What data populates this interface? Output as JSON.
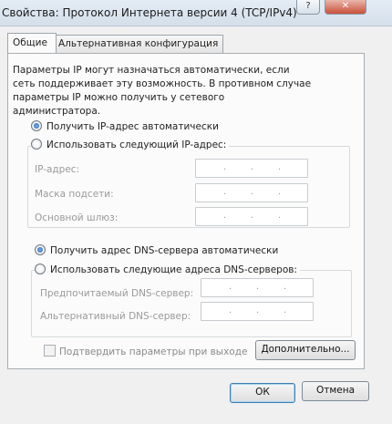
{
  "window": {
    "title": "Свойства: Протокол Интернета версии 4 (TCP/IPv4)",
    "help_glyph": "?",
    "close_glyph": "✕"
  },
  "tabs": [
    {
      "label": "Общие",
      "active": true
    },
    {
      "label": "Альтернативная конфигурация",
      "active": false
    }
  ],
  "description": "Параметры IP могут назначаться автоматически, если сеть поддерживает эту возможность. В противном случае параметры IP можно получить у сетевого администратора.",
  "ip": {
    "auto_label": "Получить IP-адрес автоматически",
    "manual_label": "Использовать следующий IP-адрес:",
    "auto_selected": true,
    "fields": [
      {
        "label": "IP-адрес:"
      },
      {
        "label": "Маска подсети:"
      },
      {
        "label": "Основной шлюз:"
      }
    ]
  },
  "dns": {
    "auto_label": "Получить адрес DNS-сервера автоматически",
    "manual_label": "Использовать следующие адреса DNS-серверов:",
    "auto_selected": true,
    "fields": [
      {
        "label": "Предпочитаемый DNS-сервер:"
      },
      {
        "label": "Альтернативный DNS-сервер:"
      }
    ]
  },
  "validate_checkbox": {
    "label": "Подтвердить параметры при выходе",
    "checked": false
  },
  "buttons": {
    "advanced": "Дополнительно...",
    "ok": "ОК",
    "cancel": "Отмена"
  },
  "ip_dot": "."
}
